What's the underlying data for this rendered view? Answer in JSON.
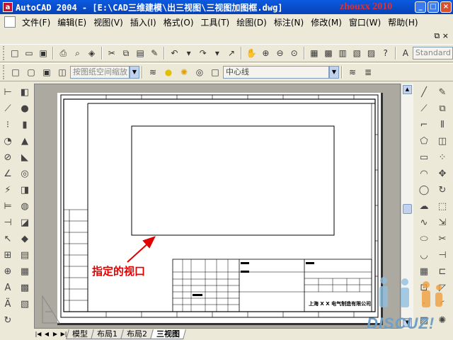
{
  "window": {
    "app_icon_label": "a",
    "title": "AutoCAD 2004 - [E:\\CAD三维建模\\出三视图\\三视图加图框.dwg]",
    "watermark": "zhouxx 2010",
    "controls": [
      "minimize",
      "maximize",
      "close"
    ]
  },
  "menubar": {
    "items": [
      {
        "label": "文件(F)"
      },
      {
        "label": "编辑(E)"
      },
      {
        "label": "视图(V)"
      },
      {
        "label": "插入(I)"
      },
      {
        "label": "格式(O)"
      },
      {
        "label": "工具(T)"
      },
      {
        "label": "绘图(D)"
      },
      {
        "label": "标注(N)"
      },
      {
        "label": "修改(M)"
      },
      {
        "label": "窗口(W)"
      },
      {
        "label": "帮助(H)"
      }
    ]
  },
  "toolbar_standard": {
    "text_style_combo": "Standard"
  },
  "toolbar_layers": {
    "viewport_scale_combo": "按图纸空间缩放",
    "layer_combo": "中心线"
  },
  "layout_tabs": {
    "tabs": [
      {
        "label": "模型",
        "active": false
      },
      {
        "label": "布局1",
        "active": false
      },
      {
        "label": "布局2",
        "active": false
      },
      {
        "label": "三视图",
        "active": true
      }
    ]
  },
  "drawing": {
    "annotation": "指定的视口",
    "company": "上海 X X 电气制造有限公司"
  },
  "watermark_logo": {
    "text": "DISCUZ!"
  },
  "colors": {
    "titlebar": "#0a5ae0",
    "annotation": "#e00000",
    "paper": "#ffffff",
    "model_space_bg": "#aca9a0"
  }
}
